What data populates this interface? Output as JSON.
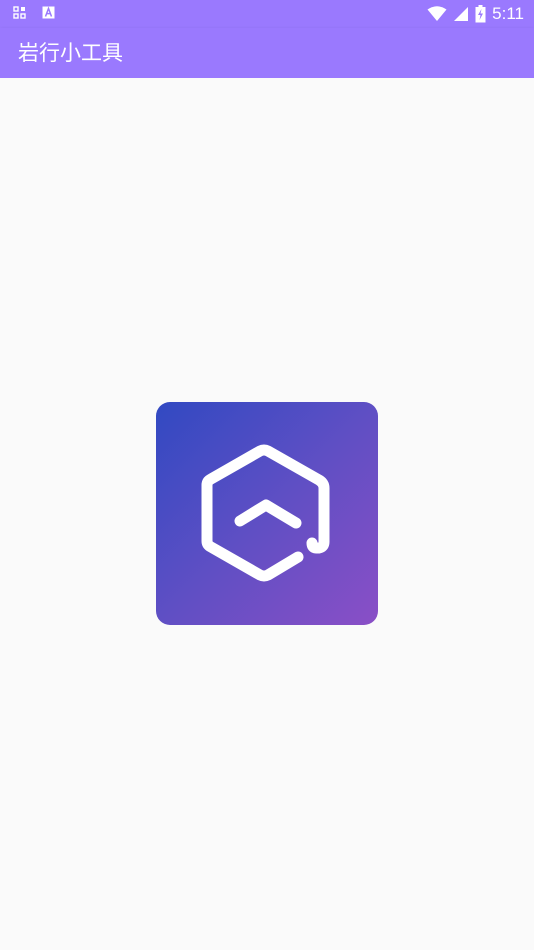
{
  "status_bar": {
    "time": "5:11",
    "left_icons": [
      "notification-grid-icon",
      "keyboard-a-icon"
    ],
    "right_icons": [
      "wifi-icon",
      "cell-signal-icon",
      "battery-charging-icon"
    ]
  },
  "app_bar": {
    "title": "岩行小工具"
  },
  "splash": {
    "logo": "app-logo-hexagon",
    "gradient_start": "#3149c2",
    "gradient_end": "#8a4fc6"
  },
  "colors": {
    "primary": "#9a79fe",
    "background": "#fafafa"
  }
}
